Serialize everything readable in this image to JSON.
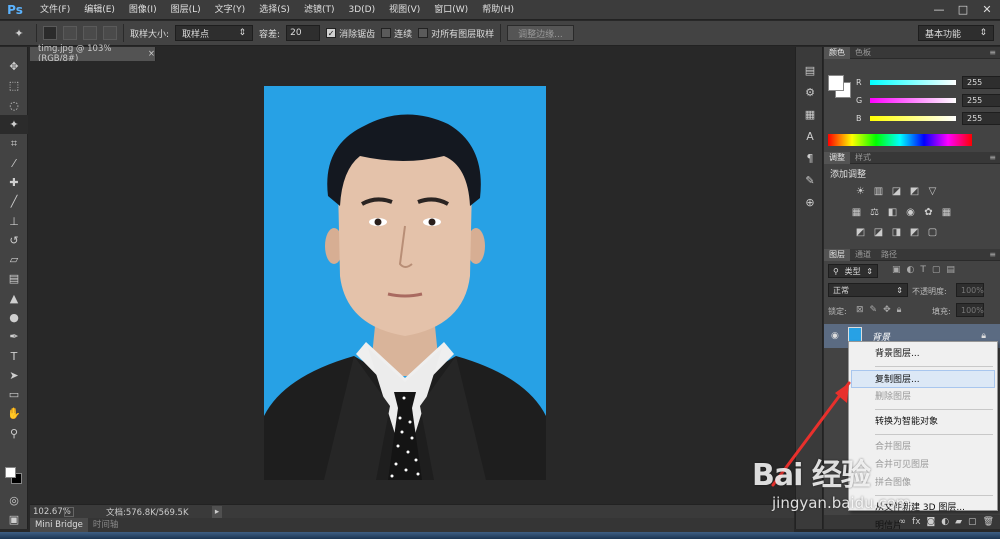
{
  "app": {
    "logo": "Ps",
    "menu": [
      "文件(F)",
      "编辑(E)",
      "图像(I)",
      "图层(L)",
      "文字(Y)",
      "选择(S)",
      "滤镜(T)",
      "3D(D)",
      "视图(V)",
      "窗口(W)",
      "帮助(H)"
    ],
    "window_controls": [
      "—",
      "□",
      "✕"
    ]
  },
  "options": {
    "sample_size_label": "取样大小:",
    "sample_size_value": "取样点",
    "tolerance_label": "容差:",
    "tolerance_value": "20",
    "antialias_label": "消除锯齿",
    "antialias_checked": true,
    "contiguous_label": "连续",
    "contiguous_checked": false,
    "all_layers_label": "对所有图层取样",
    "all_layers_checked": false,
    "refine_edge_label": "调整边缘...",
    "workspace": "基本功能"
  },
  "document": {
    "tab_title": "timg.jpg @ 103%(RGB/8#)",
    "tab_close": "×",
    "zoom": "102.67%",
    "doc_info": "文档:576.8K/569.5K",
    "bottom_tabs": [
      "Mini Bridge",
      "时间轴"
    ]
  },
  "color_panel": {
    "tabs": [
      "颜色",
      "色板"
    ],
    "r_label": "R",
    "r_value": "255",
    "g_label": "G",
    "g_value": "255",
    "b_label": "B",
    "b_value": "255"
  },
  "adjustments_panel": {
    "tabs": [
      "调整",
      "样式"
    ],
    "title": "添加调整"
  },
  "layers_panel": {
    "tabs": [
      "图层",
      "通道",
      "路径"
    ],
    "filter_label": "类型",
    "blend_mode": "正常",
    "opacity_label": "不透明度:",
    "opacity_value": "100%",
    "lock_label": "锁定:",
    "fill_label": "填充:",
    "fill_value": "100%",
    "layer_name": "背景"
  },
  "context_menu": {
    "items": [
      {
        "label": "背景图层...",
        "disabled": false
      },
      {
        "label": "复制图层...",
        "disabled": false,
        "highlighted": true
      },
      {
        "label": "删除图层",
        "disabled": true
      },
      {
        "label": "转换为智能对象",
        "disabled": false
      },
      {
        "label": "合并图层",
        "disabled": true
      },
      {
        "label": "合并可见图层",
        "disabled": true
      },
      {
        "label": "拼合图像",
        "disabled": true
      },
      {
        "label": "从文件新建 3D 图层...",
        "disabled": false
      },
      {
        "label": "明信片",
        "disabled": false
      }
    ]
  },
  "watermark": {
    "logo": "Bai 经验",
    "url": "jingyan.baidu.com"
  },
  "colors": {
    "photo_background": "#27a1e5",
    "annotation_arrow": "#e8302c"
  }
}
